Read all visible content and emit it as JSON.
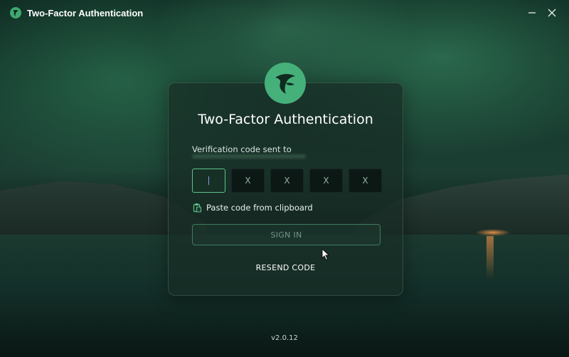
{
  "window": {
    "title": "Two-Factor Authentication",
    "logo_icon": "app-logo-icon",
    "minimize_icon": "minimize-icon",
    "close_icon": "close-icon"
  },
  "card": {
    "title": "Two-Factor Authentication",
    "sent_to_label": "Verification code sent to",
    "code_inputs": [
      {
        "value": "",
        "placeholder": "X"
      },
      {
        "value": "",
        "placeholder": "X"
      },
      {
        "value": "",
        "placeholder": "X"
      },
      {
        "value": "",
        "placeholder": "X"
      },
      {
        "value": "",
        "placeholder": "X"
      }
    ],
    "paste_label": "Paste code from clipboard",
    "paste_icon": "clipboard-icon",
    "signin_label": "SIGN IN",
    "resend_label": "RESEND CODE"
  },
  "footer": {
    "version": "v2.0.12"
  },
  "colors": {
    "accent": "#46b07a",
    "active_border": "#5ec48b",
    "button_border": "#3f7b5d",
    "card_bg": "#182c26"
  }
}
